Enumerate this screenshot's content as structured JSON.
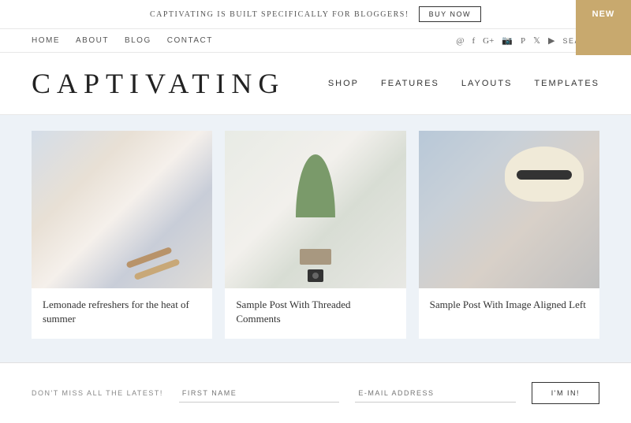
{
  "announcement": {
    "text": "CAPTIVATING IS BUILT SPECIFICALLY FOR BLOGGERS!",
    "buy_now": "BUY NOW",
    "new_badge": "NEW"
  },
  "primary_nav": {
    "links": [
      "HOME",
      "ABOUT",
      "BLOG",
      "CONTACT"
    ],
    "icons": [
      "@",
      "f",
      "G+",
      "📷",
      "P",
      "🐦",
      "▶"
    ],
    "search": "SEARCH"
  },
  "logo": {
    "text": "CAPTIVATING"
  },
  "secondary_nav": {
    "links": [
      "SHOP",
      "FEATURES",
      "LAYOUTS",
      "TEMPLATES"
    ]
  },
  "blog_posts": [
    {
      "title": "Lemonade refreshers for the heat of summer",
      "image_type": "img-1",
      "has_camera": false
    },
    {
      "title": "Sample Post With Threaded Comments",
      "image_type": "img-2",
      "has_camera": true
    },
    {
      "title": "Sample Post With Image Aligned Left",
      "image_type": "img-3",
      "has_camera": false
    }
  ],
  "newsletter": {
    "label": "DON'T MISS ALL THE LATEST!",
    "first_name_placeholder": "FIRST NAME",
    "email_placeholder": "E-MAIL ADDRESS",
    "button_label": "I'M IN!"
  }
}
